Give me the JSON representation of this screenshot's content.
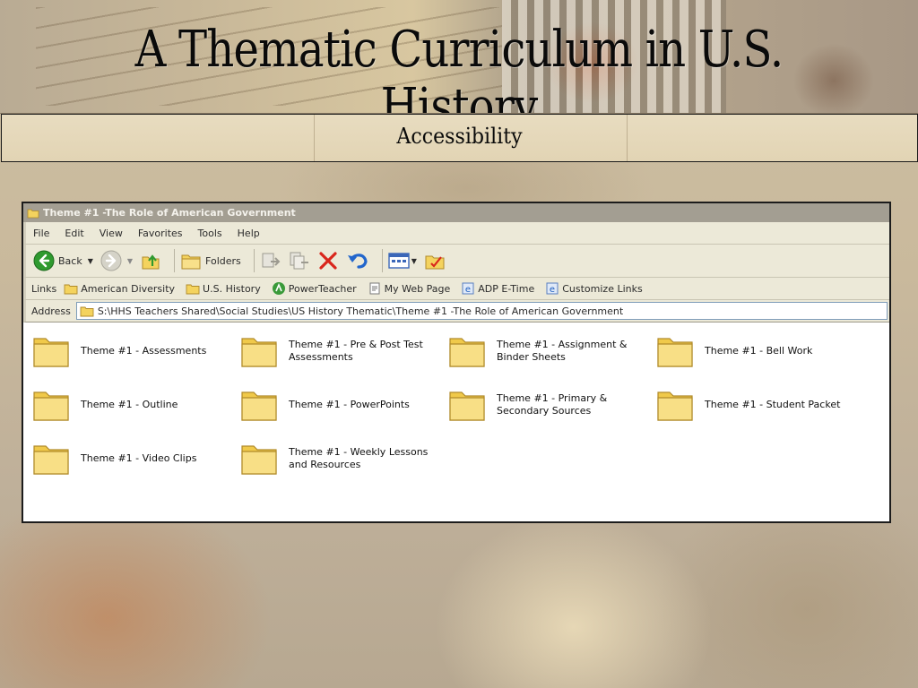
{
  "slide": {
    "title": "A Thematic Curriculum in U.S. History",
    "subtitle": "Accessibility"
  },
  "window": {
    "title": "Theme #1 -The Role of American Government",
    "menu": [
      "File",
      "Edit",
      "View",
      "Favorites",
      "Tools",
      "Help"
    ],
    "toolbar": {
      "back_label": "Back",
      "folders_label": "Folders"
    },
    "links": {
      "label": "Links",
      "items": [
        "American Diversity",
        "U.S. History",
        "PowerTeacher",
        "My Web Page",
        "ADP E-Time",
        "Customize Links"
      ]
    },
    "address": {
      "label": "Address",
      "value": "S:\\HHS Teachers Shared\\Social Studies\\US History Thematic\\Theme #1 -The Role of American Government"
    },
    "folders": [
      "Theme #1 - Assessments",
      "Theme #1 - Pre & Post Test Assessments",
      "Theme #1 - Assignment & Binder Sheets",
      "Theme #1 - Bell Work",
      "Theme #1 - Outline",
      "Theme #1 - PowerPoints",
      "Theme #1 - Primary & Secondary Sources",
      "Theme #1 - Student Packet",
      "Theme #1 - Video Clips",
      "Theme #1 - Weekly Lessons and Resources"
    ]
  },
  "colors": {
    "folder": "#f4d35e",
    "back_green": "#2f9a2f",
    "delete_red": "#d9261c",
    "undo_blue": "#2266cc"
  }
}
